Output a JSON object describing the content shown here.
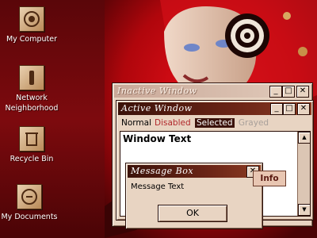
{
  "desktop": {
    "icons": [
      {
        "label": "My Computer",
        "icon": "my-computer-icon"
      },
      {
        "label": "Network Neighborhood",
        "icon": "network-neighborhood-icon"
      },
      {
        "label": "Recycle Bin",
        "icon": "recycle-bin-icon"
      },
      {
        "label": "My Documents",
        "icon": "my-documents-icon"
      }
    ]
  },
  "inactive_window": {
    "title": "Inactive Window",
    "buttons": {
      "minimize": "_",
      "maximize": "□",
      "close": "✕"
    }
  },
  "active_window": {
    "title": "Active Window",
    "buttons": {
      "minimize": "_",
      "maximize": "□",
      "close": "✕"
    },
    "menu": {
      "normal": "Normal",
      "disabled": "Disabled",
      "selected": "Selected",
      "grayed": "Grayed"
    },
    "window_text": "Window Text",
    "scroll_up": "▲",
    "scroll_down": "▼"
  },
  "message_box": {
    "title": "Message Box",
    "close": "✕",
    "text": "Message Text",
    "ok_label": "OK",
    "tooltip": "Info"
  },
  "colors": {
    "accent": "#3b120a",
    "window_face": "#e8d4c2",
    "desktop": "#7a0b0e",
    "disabled_text": "#b1272b"
  }
}
